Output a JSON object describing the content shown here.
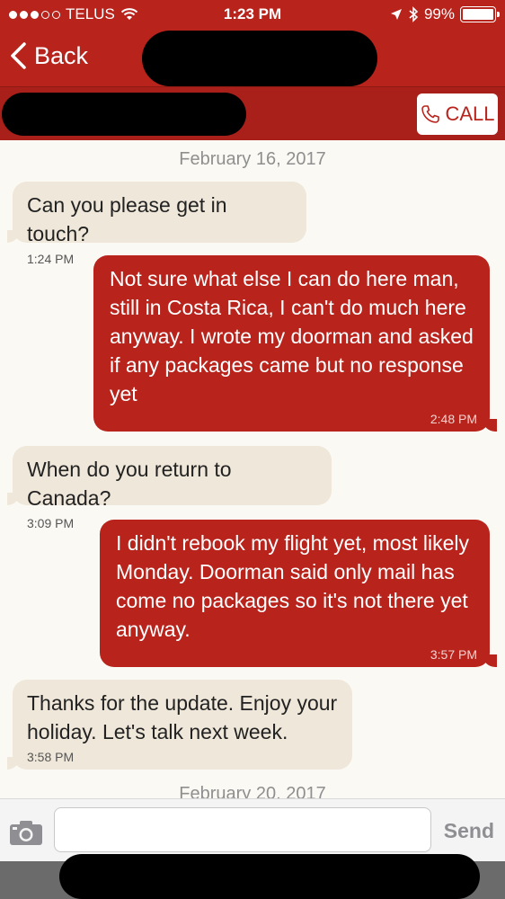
{
  "status_bar": {
    "carrier": "TELUS",
    "time": "1:23 PM",
    "battery_percent": "99%",
    "battery_level": 0.99,
    "signal_bars_filled": 3,
    "signal_bars_total": 5,
    "icons": [
      "wifi-icon",
      "location-arrow-icon",
      "bluetooth-icon",
      "battery-icon"
    ]
  },
  "header": {
    "back_label": "Back",
    "call_label": "CALL"
  },
  "conversation": {
    "dates": [
      "February 16, 2017",
      "February 20, 2017"
    ],
    "messages": [
      {
        "direction": "incoming",
        "text": "Can you please get in touch?",
        "time": "1:24 PM"
      },
      {
        "direction": "outgoing",
        "text": "Not sure what else I can do here man, still in Costa Rica,  I can't do much here anyway.  I wrote my doorman and asked if any packages came but no response yet",
        "time": "2:48 PM"
      },
      {
        "direction": "incoming",
        "text": "When do you return to Canada?",
        "time": "3:09 PM"
      },
      {
        "direction": "outgoing",
        "text": "I didn't rebook my flight yet, most likely Monday.  Doorman said only mail has come no packages so it's not there yet anyway.",
        "time": "3:57 PM"
      },
      {
        "direction": "incoming",
        "text": "Thanks for the update.  Enjoy your holiday.  Let's talk next week.",
        "time": "3:58 PM"
      }
    ]
  },
  "composer": {
    "input_value": "",
    "send_label": "Send"
  },
  "colors": {
    "brand_red": "#b8231c",
    "incoming_bubble": "#efe7d9",
    "background": "#fbf9f4"
  }
}
